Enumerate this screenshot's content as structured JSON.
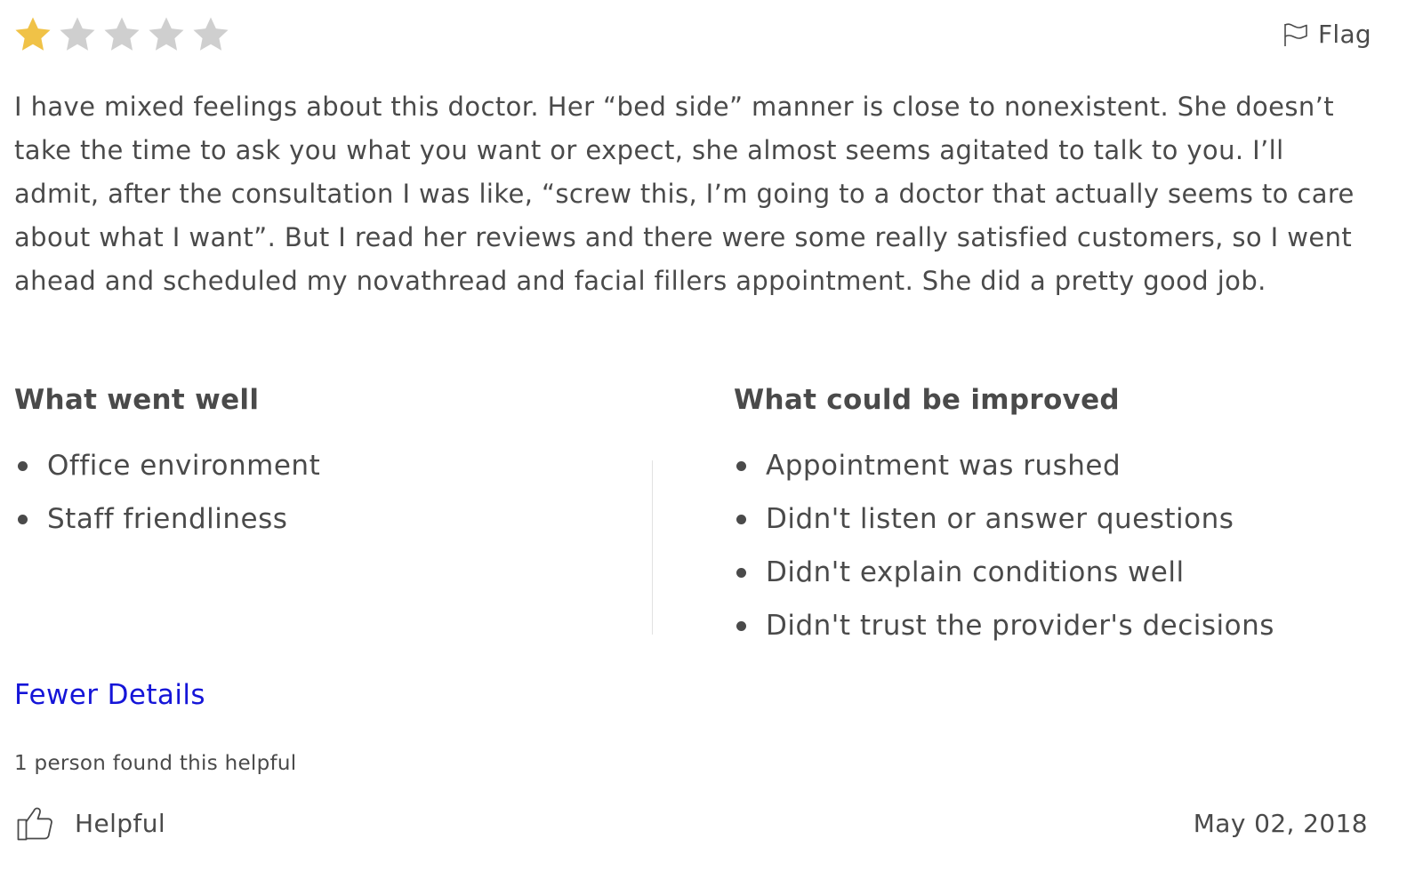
{
  "rating": {
    "value": 1,
    "max": 5,
    "filled_color": "#f0c247",
    "empty_color": "#cfcfcf",
    "icon": "star-icon"
  },
  "flag": {
    "label": "Flag",
    "icon": "flag-icon"
  },
  "review": {
    "text": "I have mixed feelings about this doctor. Her “bed side” manner is close to nonexistent. She doesn’t take the time to ask you what you want or expect, she almost seems agitated to talk to you. I’ll admit, after the consultation I was like, “screw this, I’m going to a doctor that actually seems to care about what I want”. But I read her reviews and there were some really satisfied customers, so I went ahead and scheduled my novathread and facial fillers appointment. She did a pretty good job."
  },
  "went_well": {
    "heading": "What went well",
    "items": [
      "Office environment",
      "Staff friendliness"
    ]
  },
  "could_improve": {
    "heading": "What could be improved",
    "items": [
      "Appointment was rushed",
      "Didn't listen or answer questions",
      "Didn't explain conditions well",
      "Didn't trust the provider's decisions"
    ]
  },
  "details_toggle": {
    "label": "Fewer Details",
    "color": "#1515d8"
  },
  "helpful": {
    "count_text": "1 person found this helpful",
    "button_label": "Helpful",
    "icon": "thumbs-up-icon"
  },
  "date": "May 02, 2018"
}
